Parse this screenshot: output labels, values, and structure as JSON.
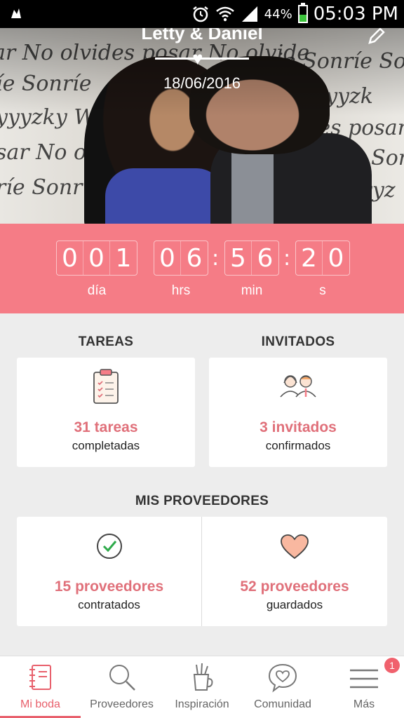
{
  "status_bar": {
    "battery_percent": "44%",
    "battery_level": 0.44,
    "time": "05:03 PM"
  },
  "hero": {
    "names": "Letty & Daniel",
    "date": "18/06/2016"
  },
  "countdown": {
    "days": [
      "0",
      "0",
      "1"
    ],
    "hours": [
      "0",
      "6"
    ],
    "minutes": [
      "5",
      "6"
    ],
    "seconds": [
      "2",
      "0"
    ],
    "labels": {
      "days": "día",
      "hours": "hrs",
      "minutes": "min",
      "seconds": "s"
    }
  },
  "tasks": {
    "title": "TAREAS",
    "count": "31 tareas",
    "caption": "completadas"
  },
  "guests": {
    "title": "INVITADOS",
    "count": "3 invitados",
    "caption": "confirmados"
  },
  "vendors": {
    "title": "MIS PROVEEDORES",
    "hired": {
      "count": "15 proveedores",
      "caption": "contratados"
    },
    "saved": {
      "count": "52 proveedores",
      "caption": "guardados"
    }
  },
  "bottom_nav": [
    {
      "label": "Mi boda",
      "active": true
    },
    {
      "label": "Proveedores"
    },
    {
      "label": "Inspiración"
    },
    {
      "label": "Comunidad"
    },
    {
      "label": "Más",
      "badge": "1"
    }
  ],
  "colors": {
    "accent": "#f57c86",
    "accent_text": "#e0707a",
    "background": "#ededed"
  }
}
